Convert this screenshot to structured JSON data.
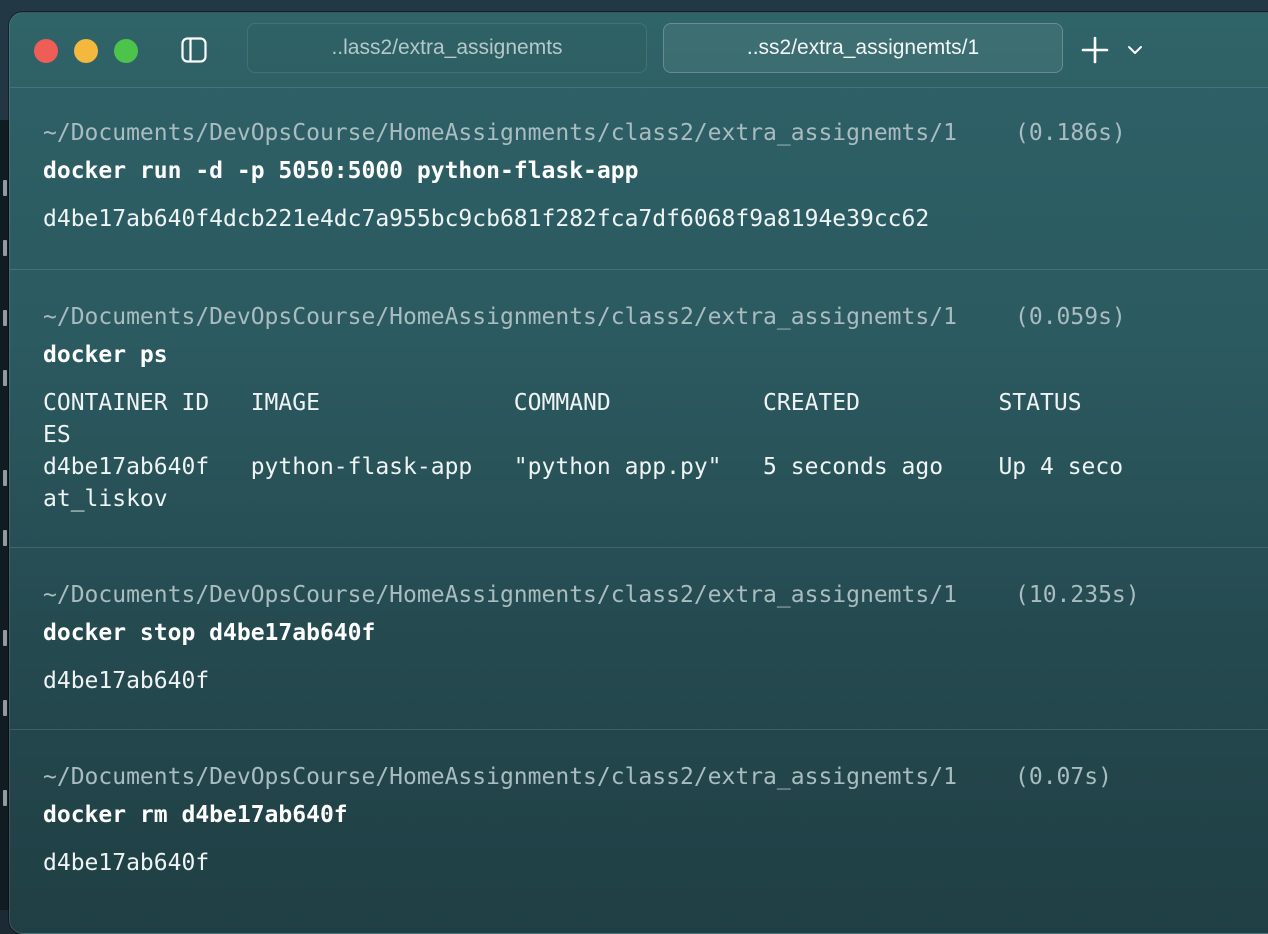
{
  "tabs": [
    {
      "label": "..lass2/extra_assignemts",
      "active": false
    },
    {
      "label": "..ss2/extra_assignemts/1",
      "active": true
    }
  ],
  "blocks": [
    {
      "path": "~/Documents/DevOpsCourse/HomeAssignments/class2/extra_assignemts/1",
      "time": "(0.186s)",
      "command": "docker run -d -p 5050:5000 python-flask-app",
      "output": [
        "d4be17ab640f4dcb221e4dc7a955bc9cb681f282fca7df6068f9a8194e39cc62"
      ]
    },
    {
      "path": "~/Documents/DevOpsCourse/HomeAssignments/class2/extra_assignemts/1",
      "time": "(0.059s)",
      "command": "docker ps",
      "output": [
        "CONTAINER ID   IMAGE              COMMAND           CREATED          STATUS",
        "ES",
        "d4be17ab640f   python-flask-app   \"python app.py\"   5 seconds ago    Up 4 seco",
        "at_liskov"
      ]
    },
    {
      "path": "~/Documents/DevOpsCourse/HomeAssignments/class2/extra_assignemts/1",
      "time": "(10.235s)",
      "command": "docker stop d4be17ab640f",
      "output": [
        "d4be17ab640f"
      ]
    },
    {
      "path": "~/Documents/DevOpsCourse/HomeAssignments/class2/extra_assignemts/1",
      "time": "(0.07s)",
      "command": "docker rm d4be17ab640f",
      "output": [
        "d4be17ab640f"
      ]
    }
  ],
  "colors": {
    "close": "#ee5e56",
    "minimize": "#f4b83e",
    "maximize": "#4cc34a"
  },
  "icons": {
    "sidebar": "sidebar-toggle-icon",
    "new_tab": "plus-icon",
    "tab_menu": "chevron-down-icon"
  }
}
